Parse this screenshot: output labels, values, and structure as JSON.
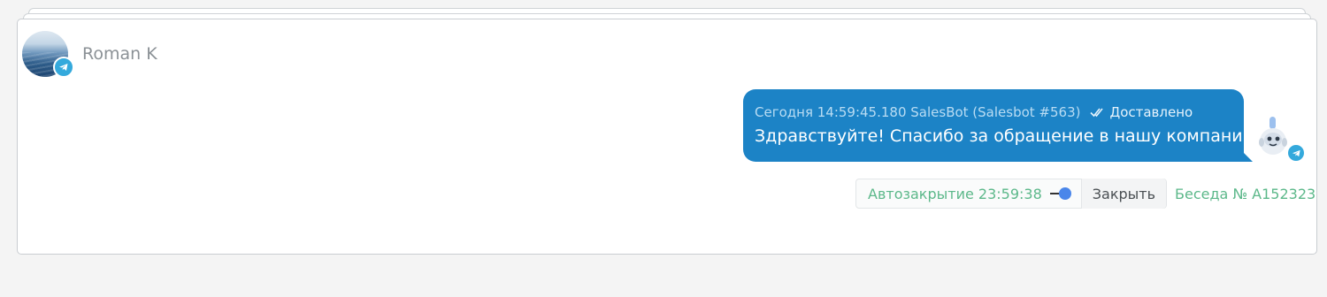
{
  "contact": {
    "name": "Roman K",
    "avatar_icon": "sea-photo-avatar",
    "channel_icon": "telegram-icon"
  },
  "message": {
    "meta": "Сегодня 14:59:45.180 SalesBot (Salesbot #563)",
    "status_icon": "double-check-icon",
    "status": "Доставлено",
    "text": "Здравствуйте! Спасибо за обращение в нашу компанию",
    "sender_icon": "robot-avatar-icon"
  },
  "controls": {
    "autoclose_label": "Автозакрытие 23:59:38",
    "autoclose_enabled": true,
    "close_button": "Закрыть",
    "conversation_id": "Беседа № A152323"
  },
  "colors": {
    "bubble": "#1c83c6",
    "accent_green": "#5cb88a",
    "toggle": "#4a86ea",
    "telegram": "#34a9dc"
  }
}
